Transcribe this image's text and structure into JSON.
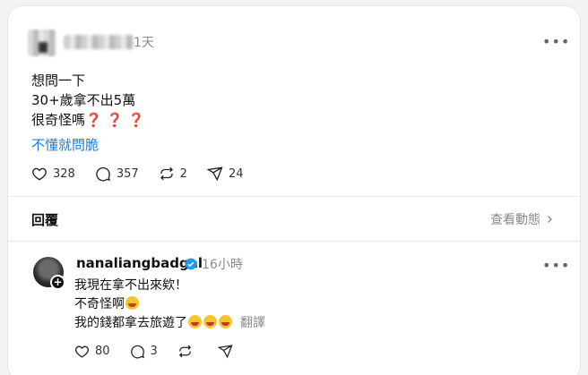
{
  "post": {
    "time": "1天",
    "lines": [
      "想問一下",
      "30+歲拿不出5萬",
      "很奇怪嗎"
    ],
    "question_marks": "❓ ❓ ❓",
    "link_text": "不懂就問脆",
    "stats": {
      "likes": "328",
      "comments": "357",
      "reposts": "2",
      "shares": "24"
    }
  },
  "replies_header": {
    "title": "回覆",
    "view_activity": "查看動態"
  },
  "reply": {
    "username": "nanaliangbadgal",
    "time": "16小時",
    "lines": [
      "我現在拿不出來欸！",
      "不奇怪啊",
      "我的錢都拿去旅遊了"
    ],
    "translate": "翻譯",
    "stats": {
      "likes": "80",
      "comments": "3"
    }
  },
  "icons": [
    "heart-icon",
    "comment-icon",
    "repost-icon",
    "share-icon",
    "more-icon",
    "chevron-right-icon",
    "verified-icon",
    "follow-plus-icon",
    "laughing-emoji"
  ]
}
